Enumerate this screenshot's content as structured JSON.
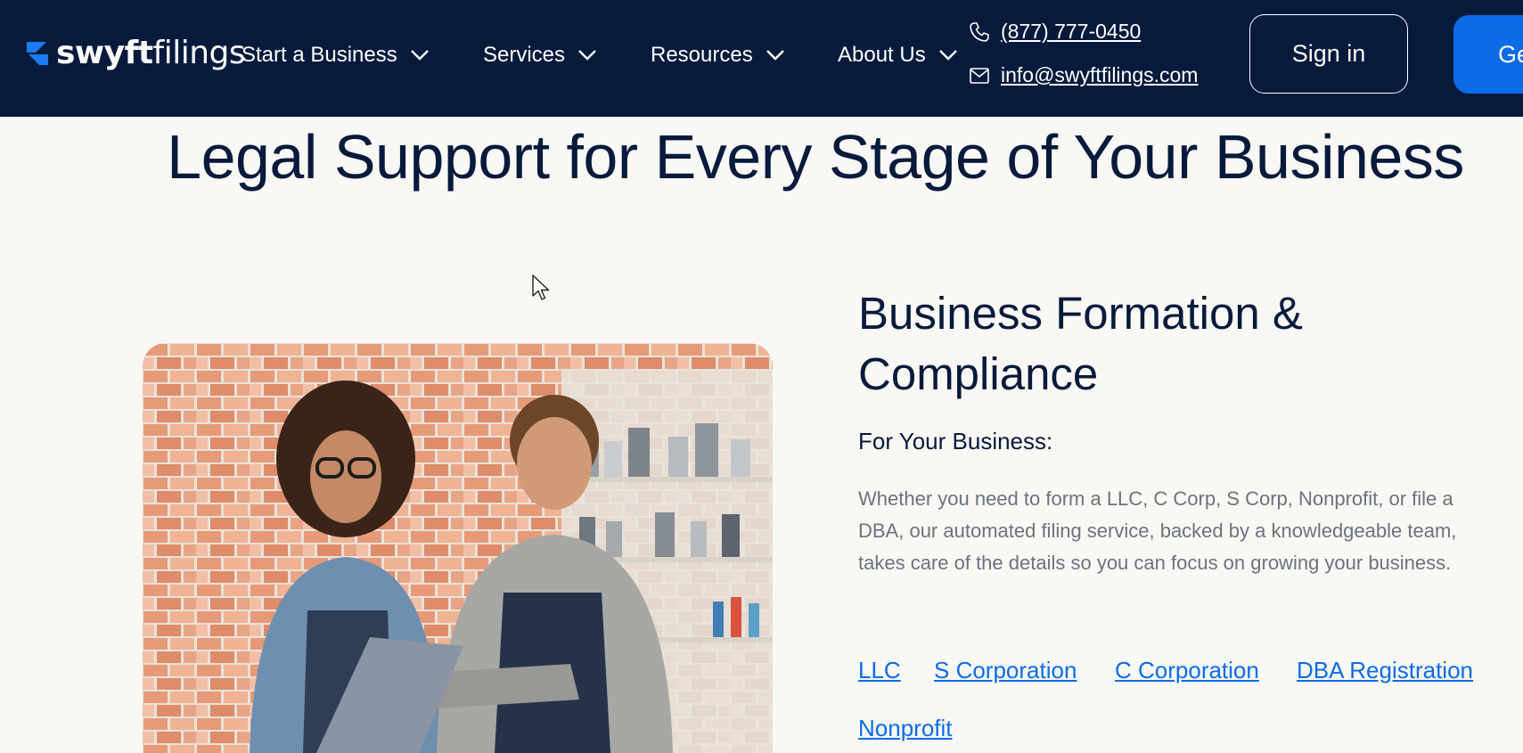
{
  "header": {
    "logo": {
      "text_bold": "swyft",
      "text_light": "filings",
      "icon": "swyft-logo-icon"
    },
    "nav": [
      {
        "label": "Start a Business",
        "icon": "chevron-down-icon"
      },
      {
        "label": "Services",
        "icon": "chevron-down-icon"
      },
      {
        "label": "Resources",
        "icon": "chevron-down-icon"
      },
      {
        "label": "About Us",
        "icon": "chevron-down-icon"
      }
    ],
    "phone": {
      "label": "(877) 777-0450",
      "icon": "phone-icon"
    },
    "email": {
      "label": "info@swyftfilings.com",
      "icon": "mail-icon"
    },
    "signin_label": "Sign in",
    "cta_label": "Ge"
  },
  "main": {
    "title": "Legal Support for Every Stage of Your Business",
    "section": {
      "title": "Business Formation & Compliance",
      "subhead": "For Your Business:",
      "description": "Whether you need to form a LLC, C Corp, S Corp, Nonprofit, or file a DBA, our automated filing service, backed by a knowledgeable team, takes care of the details so you can focus on growing your business.",
      "links": [
        "LLC",
        "S Corporation",
        "C Corporation",
        "DBA Registration",
        "Nonprofit"
      ]
    }
  },
  "colors": {
    "header_bg": "#061a3c",
    "page_bg": "#faf8f4",
    "accent": "#0b6be8",
    "heading": "#061a3c",
    "body_text": "#6b7280"
  }
}
